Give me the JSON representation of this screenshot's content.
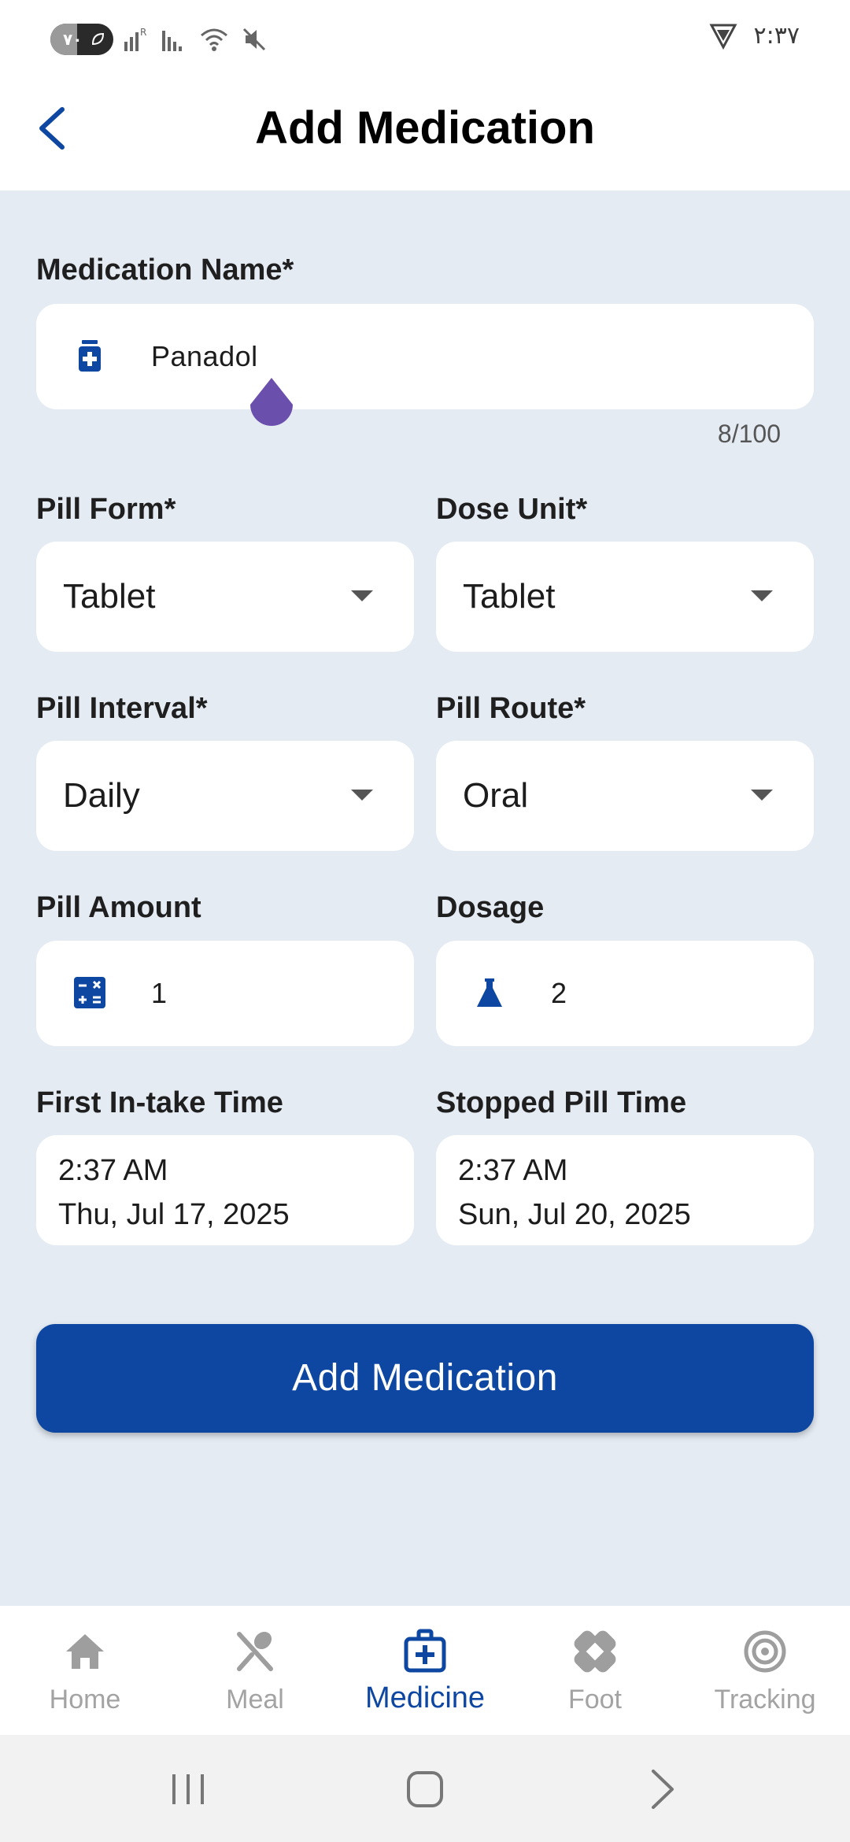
{
  "status_bar": {
    "battery": "٧٠",
    "time": "٢:٣٧"
  },
  "header": {
    "title": "Add Medication",
    "back_icon": "chevron-left-icon"
  },
  "form": {
    "medication_name": {
      "label": "Medication Name*",
      "value": "Panadol",
      "counter": "8/100",
      "icon": "medicine-bottle-icon"
    },
    "pill_form": {
      "label": "Pill Form*",
      "value": "Tablet"
    },
    "dose_unit": {
      "label": "Dose Unit*",
      "value": "Tablet"
    },
    "pill_interval": {
      "label": "Pill Interval*",
      "value": "Daily"
    },
    "pill_route": {
      "label": "Pill Route*",
      "value": "Oral"
    },
    "pill_amount": {
      "label": "Pill Amount",
      "value": "1",
      "icon": "calculator-icon"
    },
    "dosage": {
      "label": "Dosage",
      "value": "2",
      "icon": "flask-icon"
    },
    "first_intake_time": {
      "label": "First In-take Time",
      "time": "2:37 AM",
      "date": "Thu, Jul 17, 2025"
    },
    "stopped_pill_time": {
      "label": "Stopped Pill Time",
      "time": "2:37 AM",
      "date": "Sun, Jul 20, 2025"
    },
    "submit_label": "Add Medication"
  },
  "bottom_nav": {
    "items": [
      {
        "label": "Home",
        "icon": "home-icon",
        "active": false
      },
      {
        "label": "Meal",
        "icon": "fork-spoon-icon",
        "active": false
      },
      {
        "label": "Medicine",
        "icon": "medical-kit-icon",
        "active": true
      },
      {
        "label": "Foot",
        "icon": "bandage-icon",
        "active": false
      },
      {
        "label": "Tracking",
        "icon": "target-icon",
        "active": false
      }
    ]
  },
  "colors": {
    "primary": "#0e47a1",
    "background": "#e4ebf3",
    "cursor_handle": "#6b4fad",
    "inactive_nav": "#a3a3a3"
  }
}
